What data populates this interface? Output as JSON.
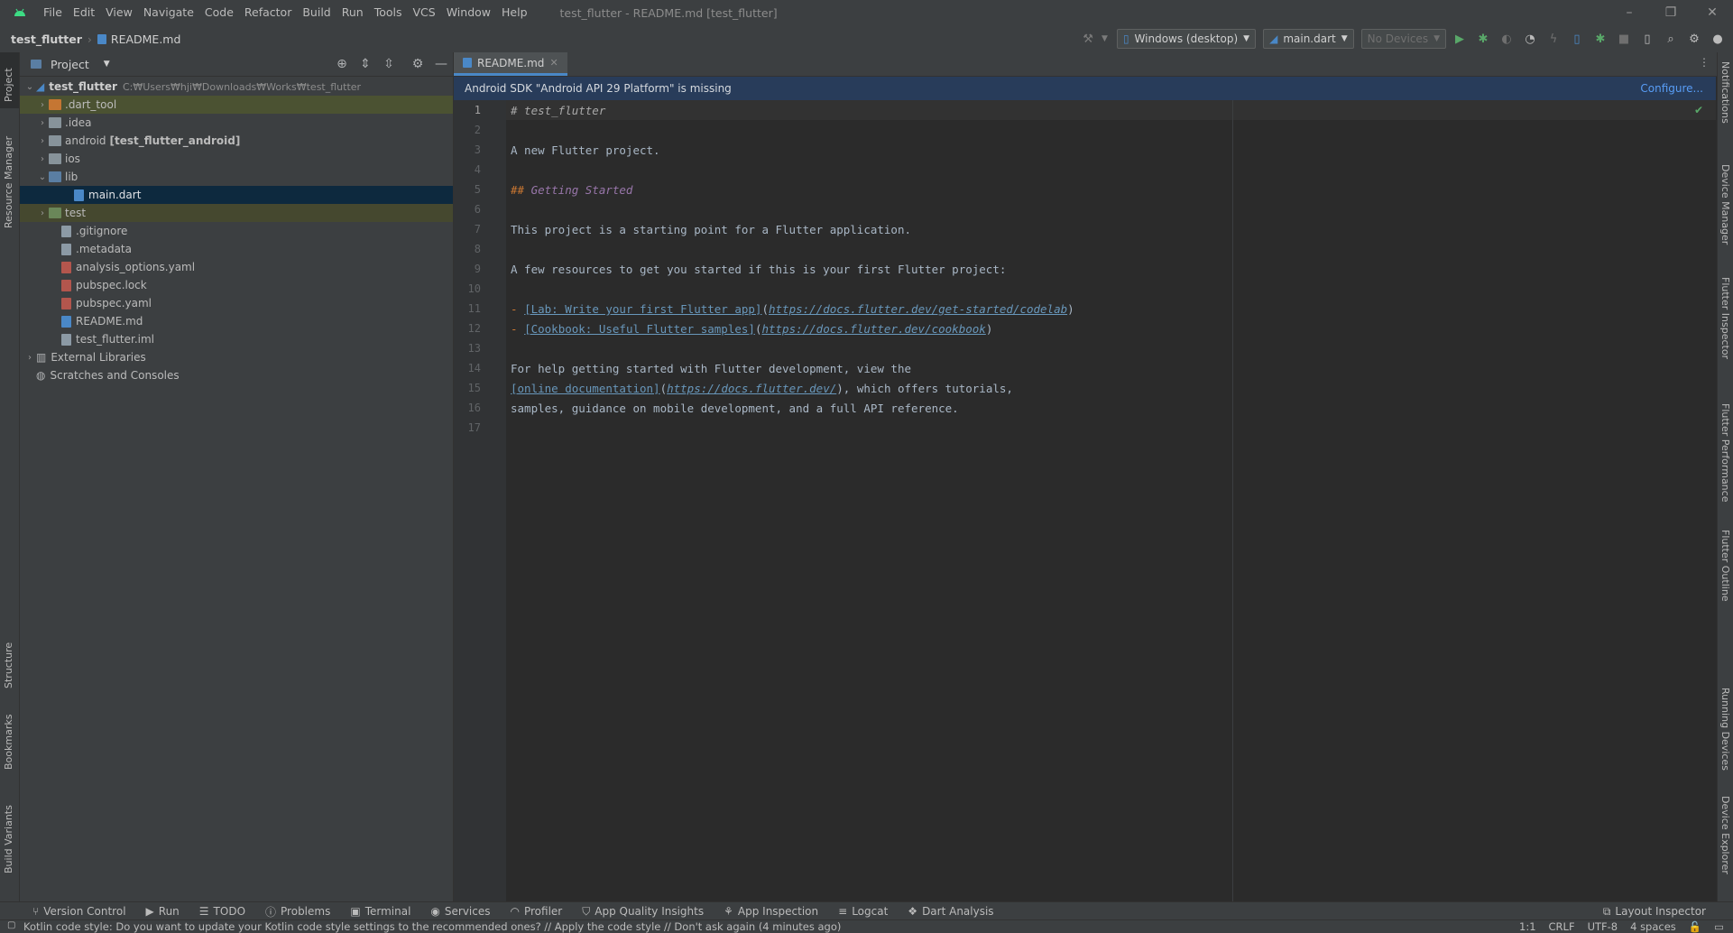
{
  "window": {
    "title": "test_flutter - README.md [test_flutter]",
    "menu": [
      "File",
      "Edit",
      "View",
      "Navigate",
      "Code",
      "Refactor",
      "Build",
      "Run",
      "Tools",
      "VCS",
      "Window",
      "Help"
    ],
    "controls": [
      "–",
      "❐",
      "✕"
    ]
  },
  "breadcrumb": {
    "project": "test_flutter",
    "file": "README.md"
  },
  "toolbar": {
    "device_combo": "Windows (desktop)",
    "run_config": "main.dart",
    "no_devices": "No Devices"
  },
  "left_stripe": {
    "top": [
      "Project",
      "Resource Manager"
    ],
    "bottom": [
      "Structure",
      "Bookmarks",
      "Build Variants"
    ]
  },
  "project_panel": {
    "title": "Project",
    "root_name": "test_flutter",
    "root_path": "C:₩Users₩hji₩Downloads₩Works₩test_flutter",
    "items": [
      {
        "name": ".dart_tool"
      },
      {
        "name": ".idea"
      },
      {
        "name": "android",
        "extra": "[test_flutter_android]"
      },
      {
        "name": "ios"
      },
      {
        "name": "lib"
      },
      {
        "name": "main.dart"
      },
      {
        "name": "test"
      },
      {
        "name": ".gitignore"
      },
      {
        "name": ".metadata"
      },
      {
        "name": "analysis_options.yaml"
      },
      {
        "name": "pubspec.lock"
      },
      {
        "name": "pubspec.yaml"
      },
      {
        "name": "README.md"
      },
      {
        "name": "test_flutter.iml"
      },
      {
        "name": "External Libraries"
      },
      {
        "name": "Scratches and Consoles"
      }
    ]
  },
  "editor": {
    "tab": "README.md",
    "banner_text": "Android SDK \"Android API 29 Platform\" is missing",
    "banner_action": "Configure...",
    "line_numbers": [
      "1",
      "2",
      "3",
      "4",
      "5",
      "6",
      "7",
      "8",
      "9",
      "10",
      "11",
      "12",
      "13",
      "14",
      "15",
      "16",
      "17"
    ],
    "lines": {
      "l1": "# test_flutter",
      "l3": "A new Flutter project.",
      "l5_prefix": "## ",
      "l5_text": "Getting Started",
      "l7": "This project is a starting point for a Flutter application.",
      "l9": "A few resources to get you started if this is your first Flutter project:",
      "l11_dash": "- ",
      "l11_link": "[Lab: Write your first Flutter app]",
      "l11_url": "https://docs.flutter.dev/get-started/codelab",
      "l12_dash": "- ",
      "l12_link": "[Cookbook: Useful Flutter samples]",
      "l12_url": "https://docs.flutter.dev/cookbook",
      "l14": "For help getting started with Flutter development, view the",
      "l15_link": "[online documentation]",
      "l15_url": "https://docs.flutter.dev/",
      "l15_rest": ", which offers tutorials,",
      "l16": "samples, guidance on mobile development, and a full API reference."
    }
  },
  "right_stripe": [
    "Notifications",
    "Device Manager",
    "Flutter Inspector",
    "Flutter Performance",
    "Flutter Outline",
    "Running Devices",
    "Device Explorer"
  ],
  "bottom_tools": [
    "Version Control",
    "Run",
    "TODO",
    "Problems",
    "Terminal",
    "Services",
    "Profiler",
    "App Quality Insights",
    "App Inspection",
    "Logcat",
    "Dart Analysis"
  ],
  "layout_inspector": "Layout Inspector",
  "status": {
    "message": "Kotlin code style: Do you want to update your Kotlin code style settings to the recommended ones? // Apply the code style // Don't ask again (4 minutes ago)",
    "position": "1:1",
    "line_sep": "CRLF",
    "encoding": "UTF-8",
    "indent": "4 spaces"
  },
  "colors": {
    "accent": "#4a88c7",
    "android_green": "#3ddc84",
    "run_green": "#59a869"
  }
}
